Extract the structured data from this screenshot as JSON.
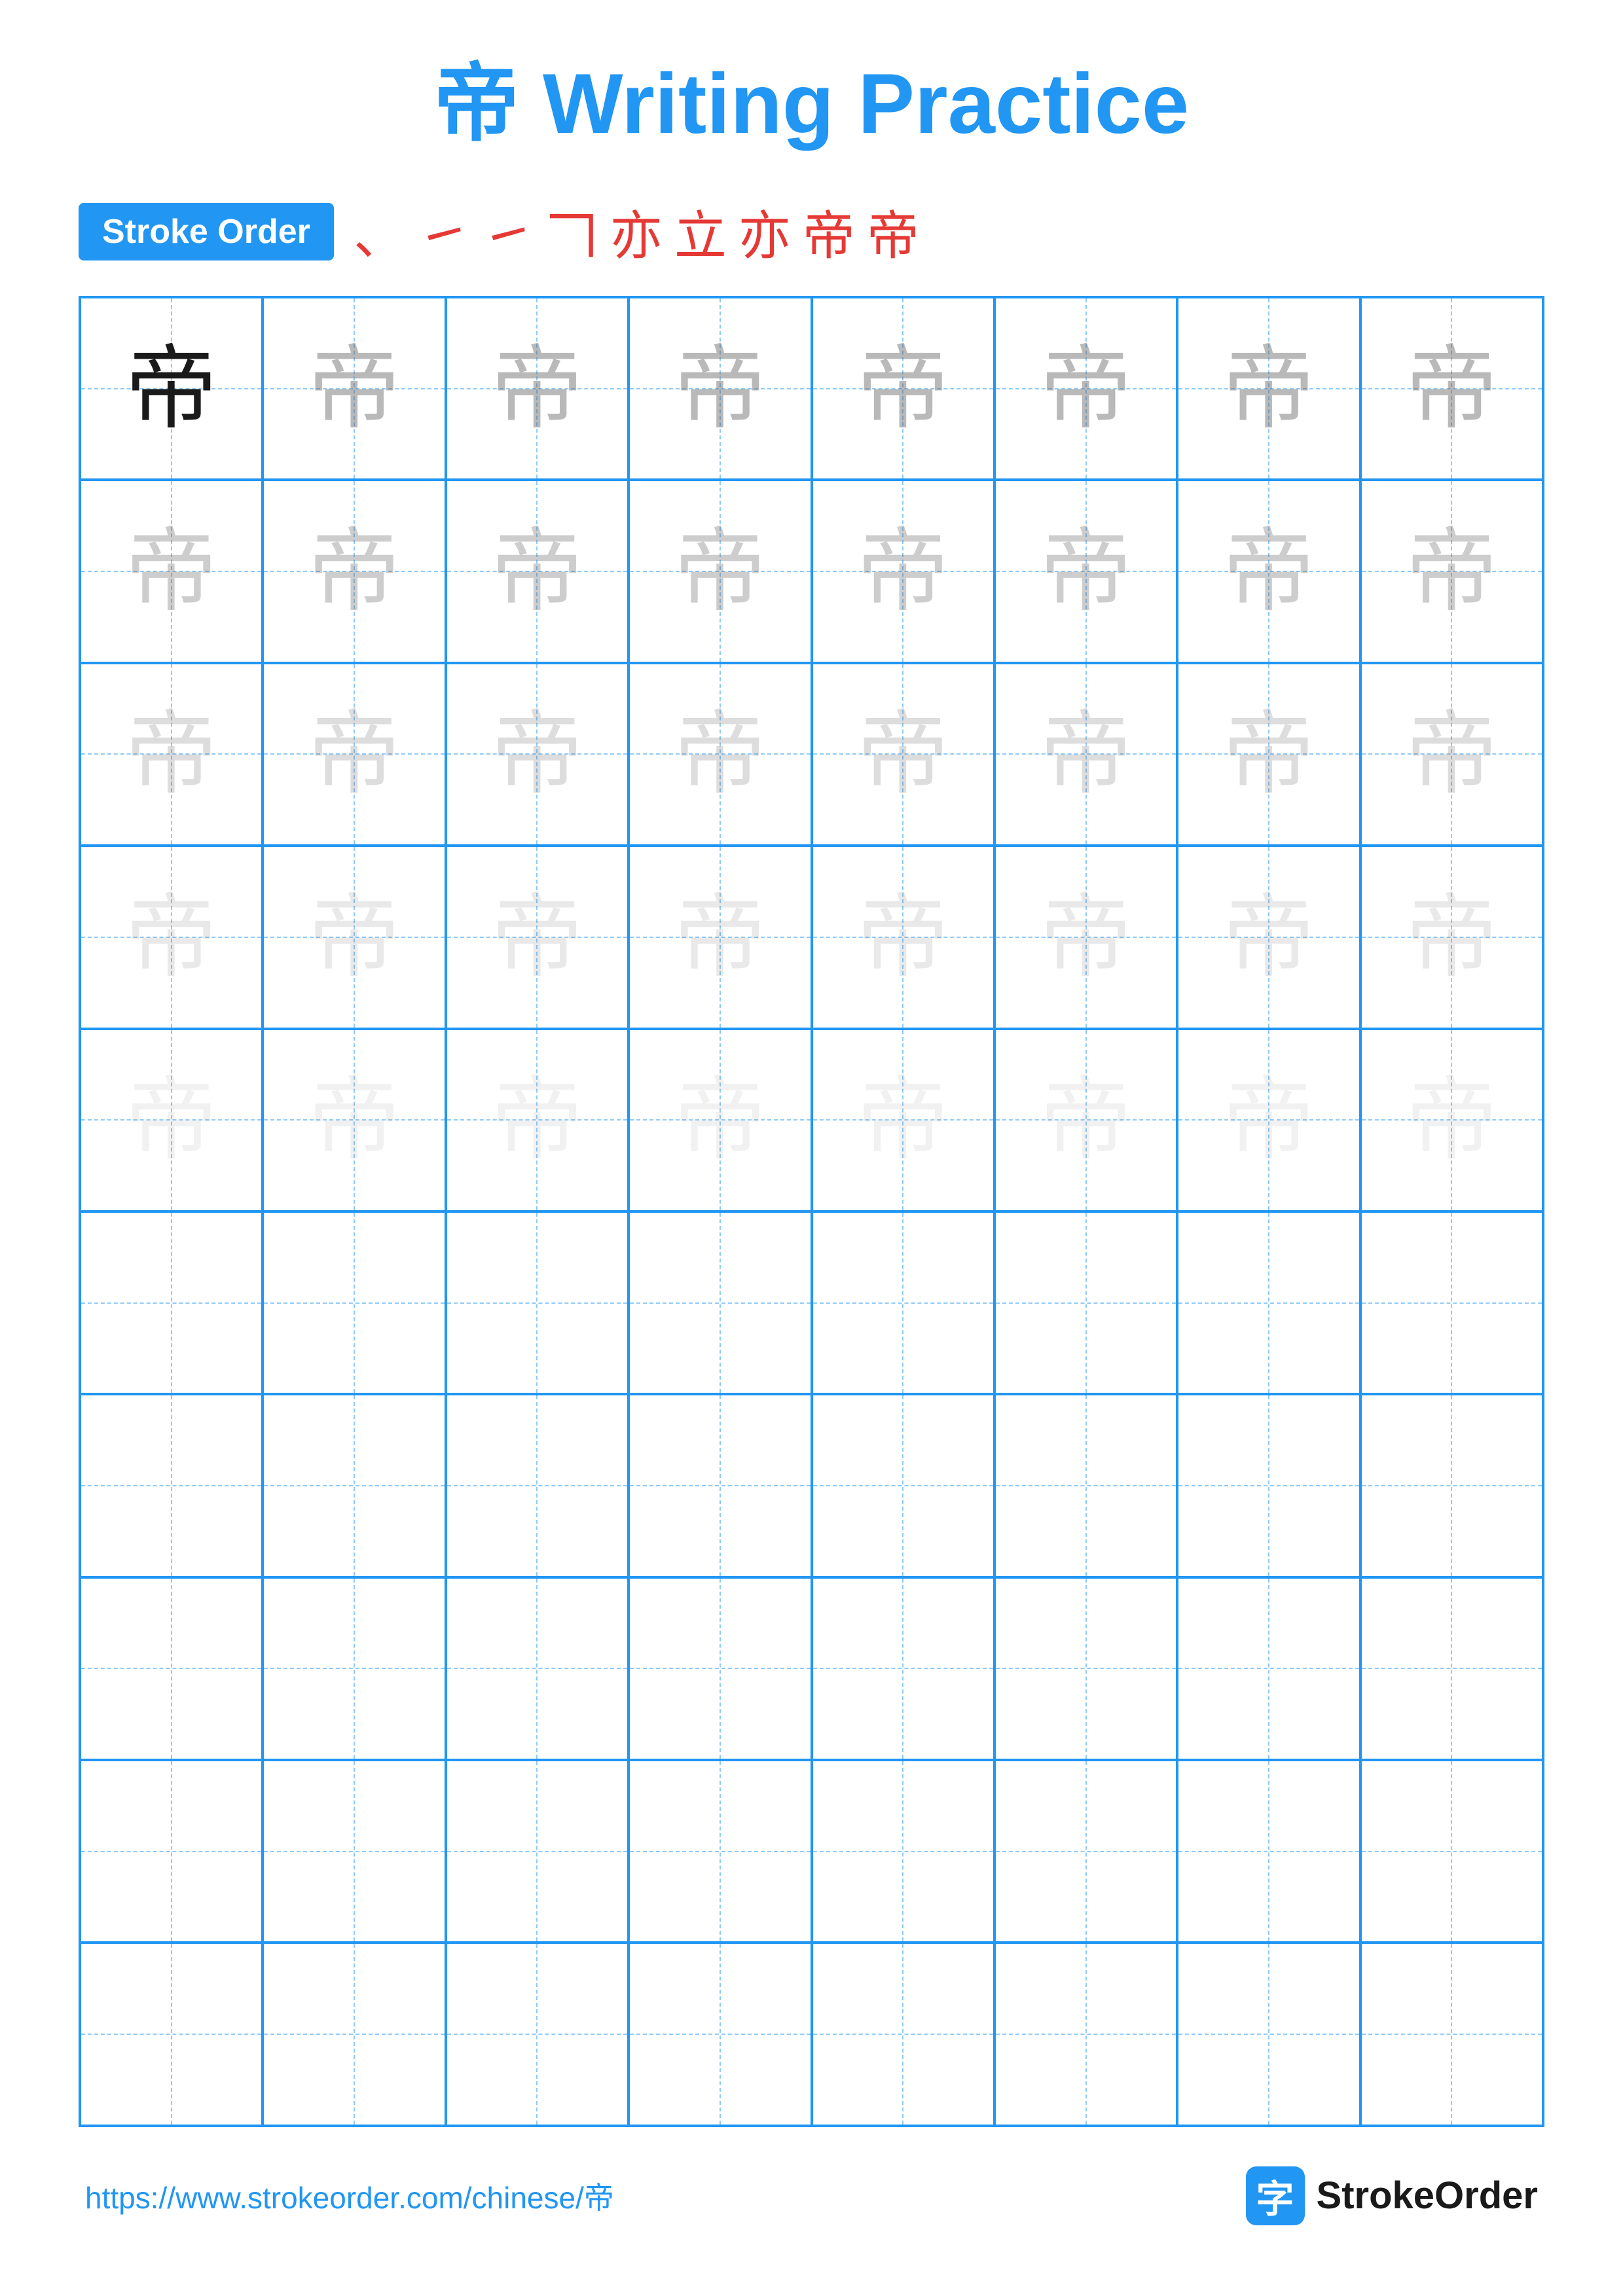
{
  "title": {
    "char": "帝",
    "suffix": " Writing Practice"
  },
  "stroke_order": {
    "badge_label": "Stroke Order",
    "strokes": [
      "丶",
      "㇀",
      "㇀",
      "𠃍",
      "亦",
      "立",
      "亦",
      "帝",
      "帝"
    ]
  },
  "grid": {
    "character": "帝",
    "rows": 10,
    "cols": 8,
    "fade_levels": [
      "dark",
      "fade1",
      "fade1",
      "fade1",
      "fade1",
      "fade1",
      "fade1",
      "fade1",
      "fade2",
      "fade2",
      "fade2",
      "fade2",
      "fade2",
      "fade2",
      "fade2",
      "fade2",
      "fade3",
      "fade3",
      "fade3",
      "fade3",
      "fade3",
      "fade3",
      "fade3",
      "fade3",
      "fade4",
      "fade4",
      "fade4",
      "fade4",
      "fade4",
      "fade4",
      "fade4",
      "fade4",
      "fade5",
      "fade5",
      "fade5",
      "fade5",
      "fade5",
      "fade5",
      "fade5",
      "fade5"
    ]
  },
  "footer": {
    "url": "https://www.strokeorder.com/chinese/帝",
    "brand_label": "StrokeOrder",
    "brand_icon": "字"
  }
}
